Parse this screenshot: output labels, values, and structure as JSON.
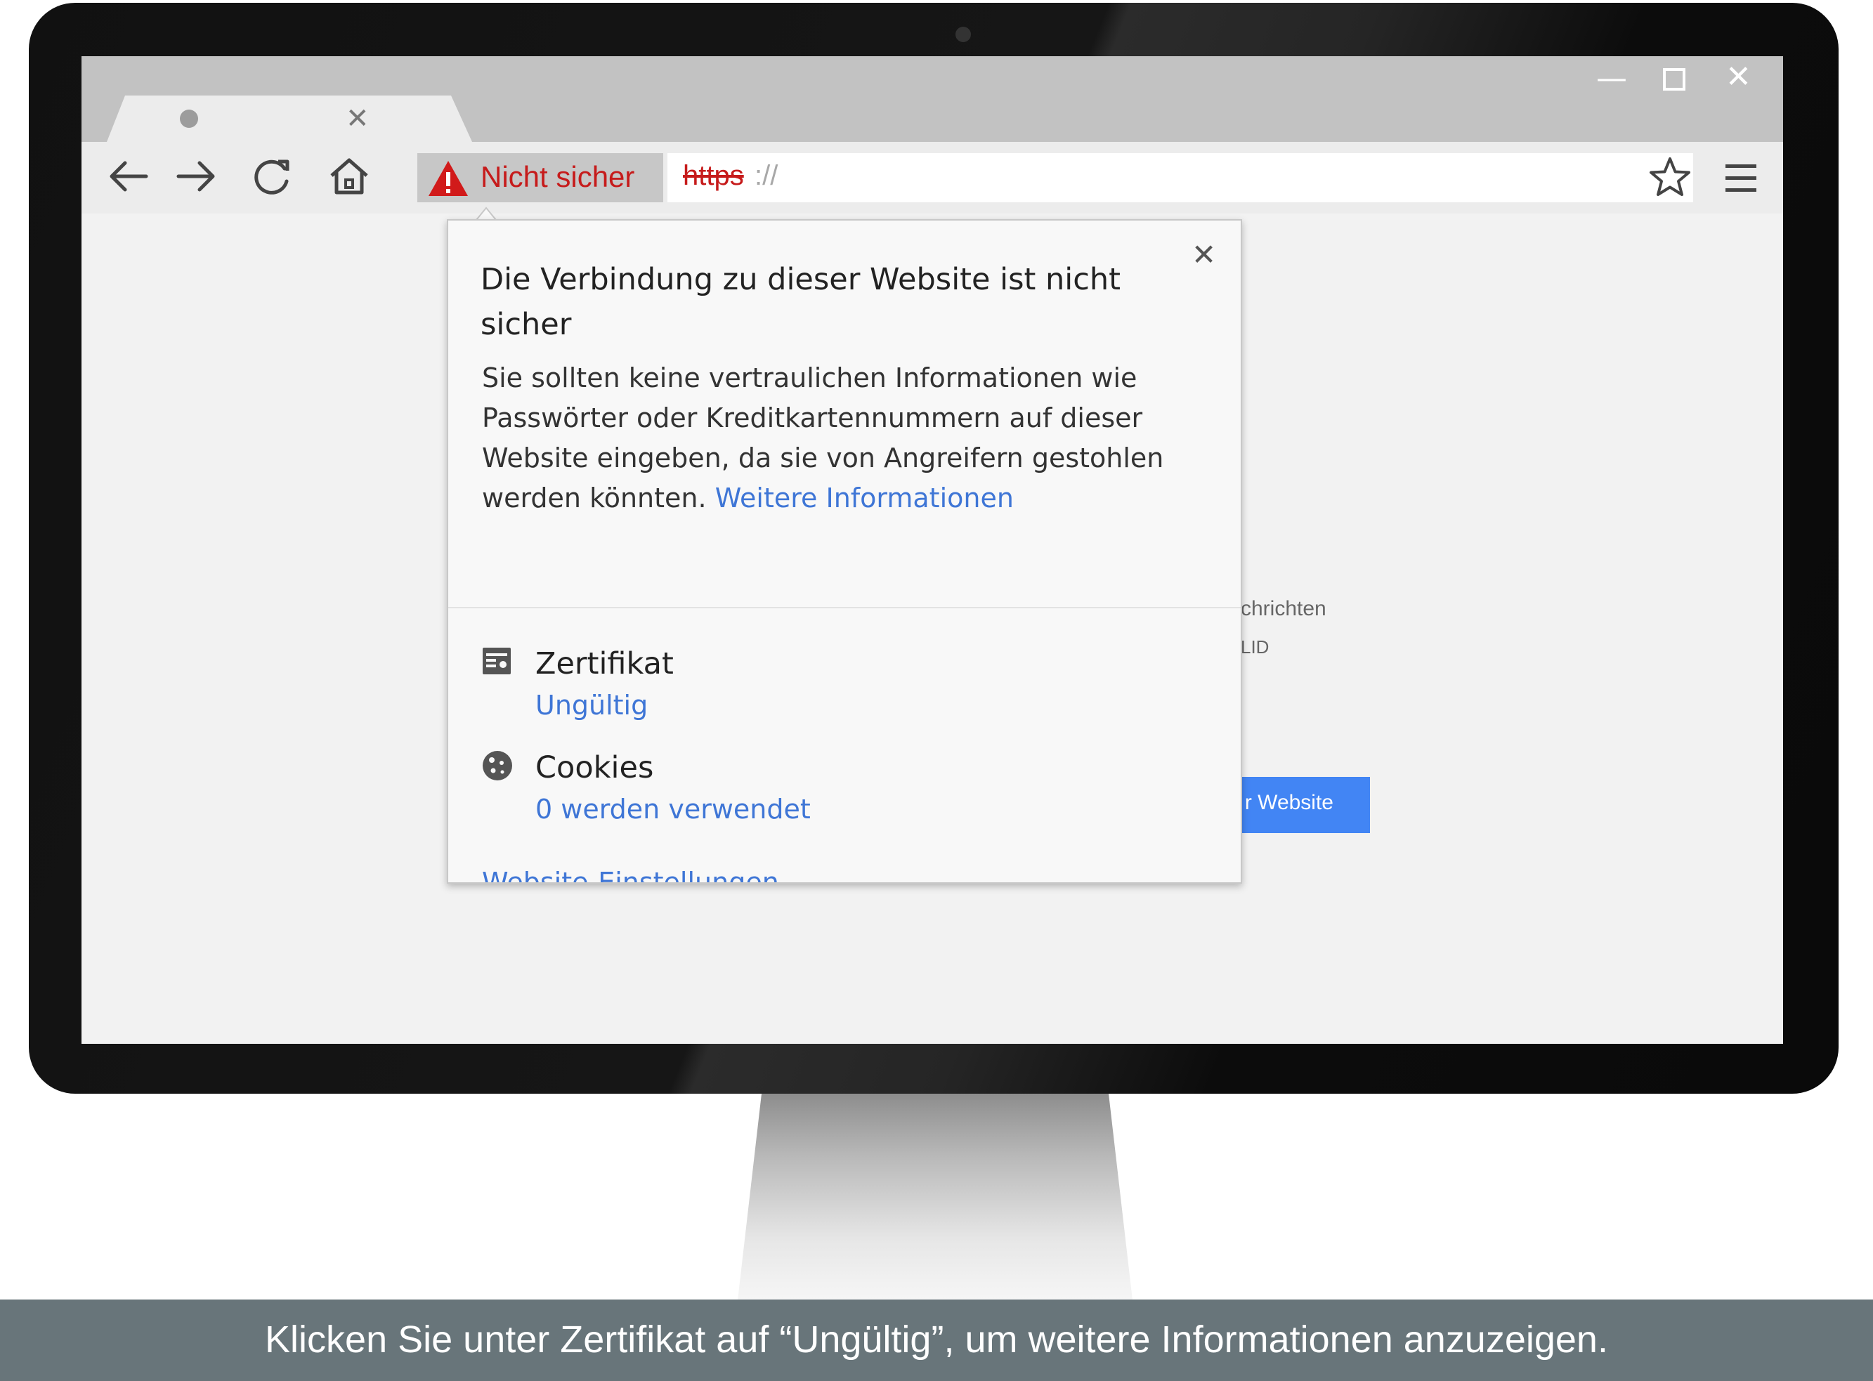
{
  "browser": {
    "security_chip": {
      "label": "Nicht sicher",
      "icon": "warning-triangle-icon",
      "color": "#c61b1b"
    },
    "address": {
      "scheme": "https",
      "rest": "://"
    },
    "nav_icons": [
      "back-arrow-icon",
      "forward-arrow-icon",
      "reload-icon",
      "home-icon"
    ],
    "window_controls": [
      "minimize",
      "maximize",
      "close"
    ]
  },
  "page_behind": {
    "text_1": "chrichten",
    "text_2": "LID",
    "button_label": "r Website",
    "button_color": "#4285f4"
  },
  "popup": {
    "title": "Die Verbindung zu dieser Website ist nicht sicher",
    "body": "Sie sollten keine vertraulichen Informationen wie Passwörter oder Kreditkartennummern auf dieser Website eingeben, da sie von Angreifern gestohlen werden könnten.",
    "learn_more": "Weitere Informationen",
    "certificate": {
      "label": "Zertifikat",
      "status": "Ungültig",
      "icon": "certificate-icon"
    },
    "cookies": {
      "label": "Cookies",
      "status": "0 werden verwendet",
      "icon": "cookie-icon"
    },
    "settings_link": "Website-Einstellungen",
    "link_color": "#3f76d6"
  },
  "caption": "Klicken Sie unter Zertifikat auf “Ungültig”, um weitere Informationen anzuzeigen."
}
